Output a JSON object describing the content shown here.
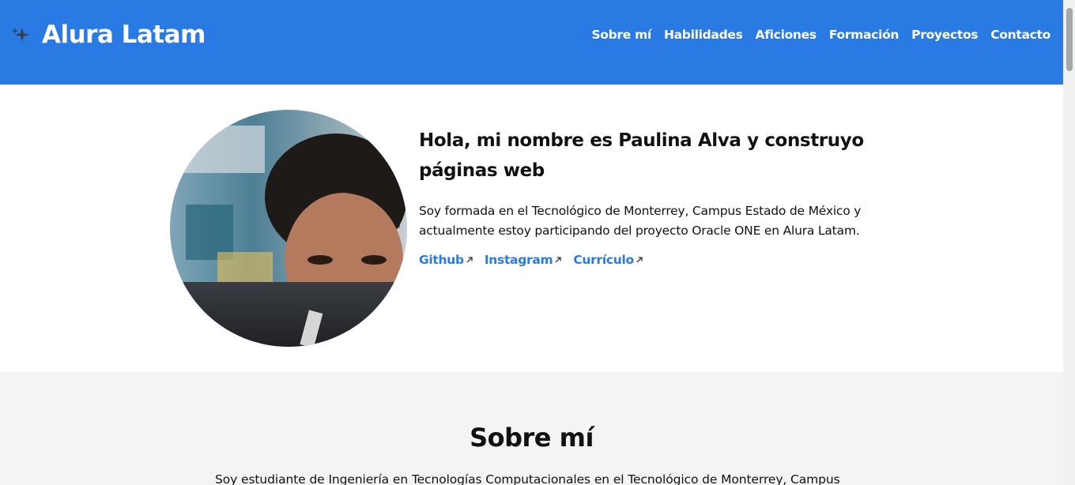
{
  "header": {
    "brand": "Alura Latam",
    "nav": [
      "Sobre mí",
      "Habilidades",
      "Aficiones",
      "Formación",
      "Proyectos",
      "Contacto"
    ]
  },
  "hero": {
    "title": "Hola, mi nombre es Paulina Alva y construyo páginas web",
    "description": "Soy formada en el Tecnológico de Monterrey, Campus Estado de México y actualmente estoy participando del proyecto Oracle ONE en Alura Latam.",
    "links": [
      "Github",
      "Instagram",
      "Currículo"
    ],
    "avatar_icon": "profile-photo"
  },
  "about": {
    "title": "Sobre mí",
    "text": "Soy estudiante de Ingeniería en Tecnologías Computacionales en el Tecnológico de Monterrey, Campus"
  },
  "colors": {
    "primary": "#2a7ae4",
    "section_bg": "#f4f4f4",
    "text": "#111111"
  }
}
